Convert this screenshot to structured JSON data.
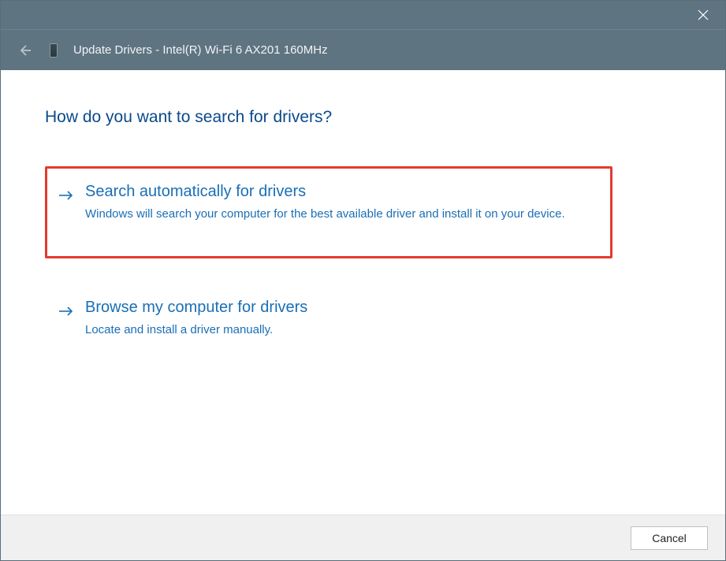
{
  "colors": {
    "header_bg": "#5f7481",
    "link_blue": "#1a6fb5",
    "title_blue": "#0b4a8a",
    "highlight_red": "#e23b2e"
  },
  "titlebar": {
    "close_label": "Close"
  },
  "header": {
    "back_label": "Back",
    "device_icon": "device-icon",
    "title": "Update Drivers - Intel(R) Wi-Fi 6 AX201 160MHz"
  },
  "page": {
    "title": "How do you want to search for drivers?"
  },
  "options": [
    {
      "title": "Search automatically for drivers",
      "description": "Windows will search your computer for the best available driver and install it on your device.",
      "highlighted": true
    },
    {
      "title": "Browse my computer for drivers",
      "description": "Locate and install a driver manually.",
      "highlighted": false
    }
  ],
  "footer": {
    "cancel_label": "Cancel"
  }
}
